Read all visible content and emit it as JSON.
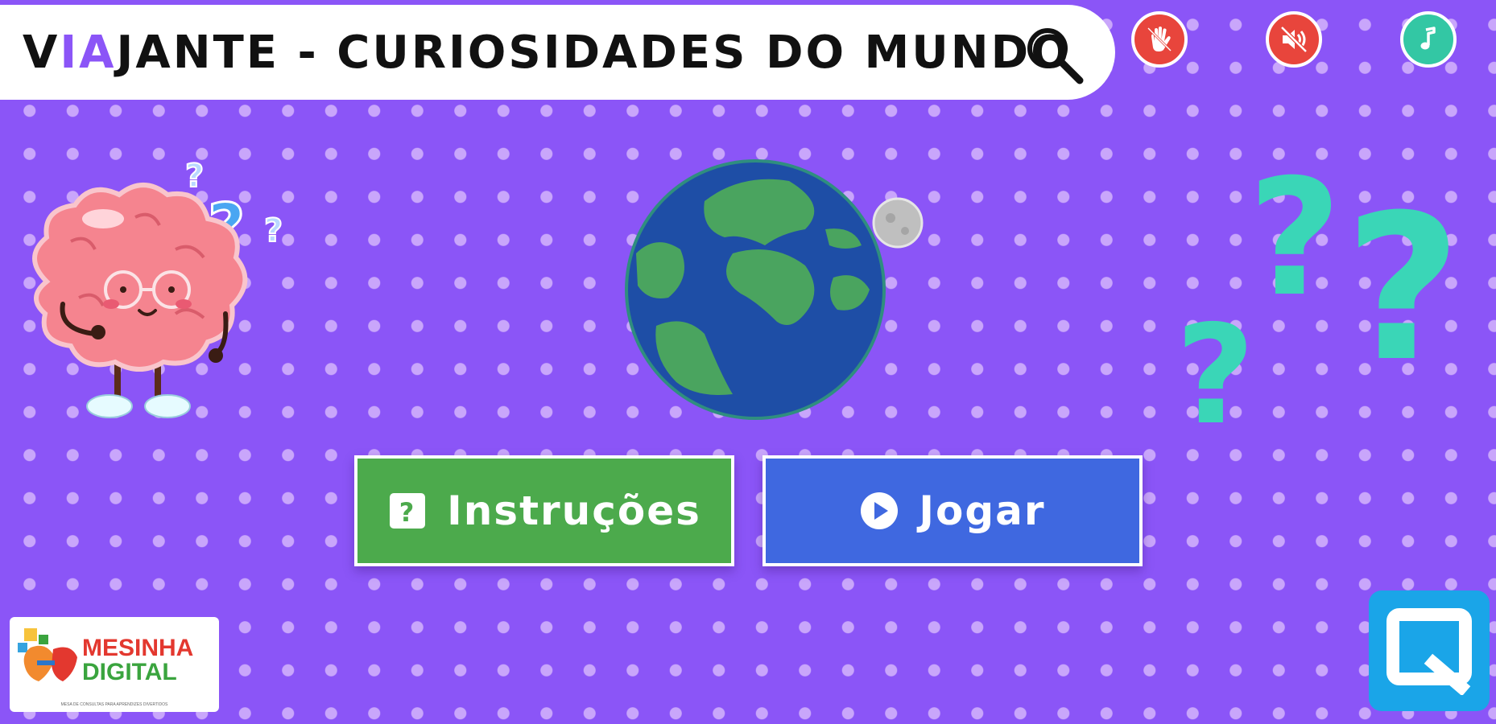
{
  "title": {
    "part1": "V",
    "accent": "IA",
    "part2": "JANTE - CURIOSIDADES DO MUNDO"
  },
  "top_controls": [
    {
      "icon": "hand-stop-icon",
      "color": "#e8453c"
    },
    {
      "icon": "mute-sound-icon",
      "color": "#e8453c"
    },
    {
      "icon": "music-note-icon",
      "color": "#33c7a4"
    }
  ],
  "buttons": {
    "instructions_label": "Instruções",
    "play_label": "Jogar",
    "instructions_color": "#4caa4c",
    "play_color": "#3f68e0"
  },
  "logo": {
    "line1": "MESINHA",
    "line2": "DIGITAL",
    "tagline": "MESA DE CONSULTAS PARA APRENDIZES DIVERTIDOS"
  },
  "colors": {
    "background": "#8b55f7",
    "dots": "#c9a6fb",
    "question_marks": "#3ad6b7",
    "accent": "#8b55f7"
  }
}
